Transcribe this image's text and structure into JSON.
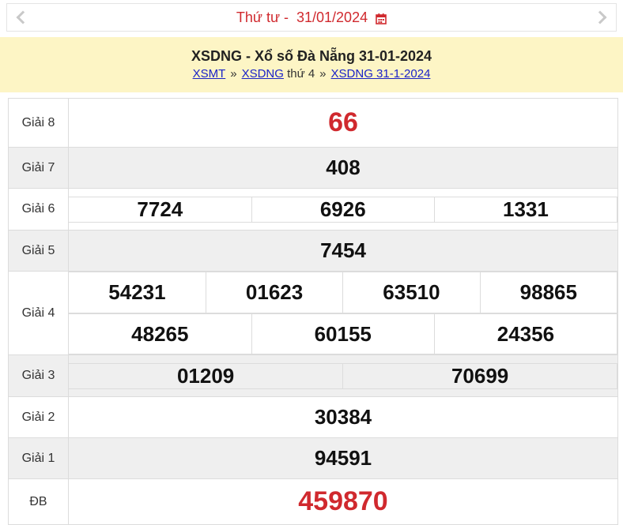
{
  "nav": {
    "weekday": "Thứ tư -",
    "date": "31/01/2024",
    "prev_icon": "chevron-left-icon",
    "next_icon": "chevron-right-icon",
    "calendar_icon": "calendar-icon"
  },
  "header": {
    "title": "XSDNG - Xổ số Đà Nẵng 31-01-2024",
    "crumb1": "XSMT",
    "sep1": "»",
    "crumb2": "XSDNG",
    "crumb2_suffix": "thứ 4",
    "sep2": "»",
    "crumb3": "XSDNG 31-1-2024"
  },
  "results": {
    "g8": {
      "label": "Giải 8",
      "numbers": [
        "66"
      ]
    },
    "g7": {
      "label": "Giải 7",
      "numbers": [
        "408"
      ]
    },
    "g6": {
      "label": "Giải 6",
      "numbers": [
        "7724",
        "6926",
        "1331"
      ]
    },
    "g5": {
      "label": "Giải 5",
      "numbers": [
        "7454"
      ]
    },
    "g4": {
      "label": "Giải 4",
      "row1": [
        "54231",
        "01623",
        "63510",
        "98865"
      ],
      "row2": [
        "48265",
        "60155",
        "24356"
      ]
    },
    "g3": {
      "label": "Giải 3",
      "numbers": [
        "01209",
        "70699"
      ]
    },
    "g2": {
      "label": "Giải 2",
      "numbers": [
        "30384"
      ]
    },
    "g1": {
      "label": "Giải 1",
      "numbers": [
        "94591"
      ]
    },
    "db": {
      "label": "ĐB",
      "numbers": [
        "459870"
      ]
    }
  },
  "colors": {
    "accent_red": "#d0292e",
    "header_bg": "#fdf5c5",
    "link": "#1a22c8",
    "row_alt": "#efefef"
  }
}
